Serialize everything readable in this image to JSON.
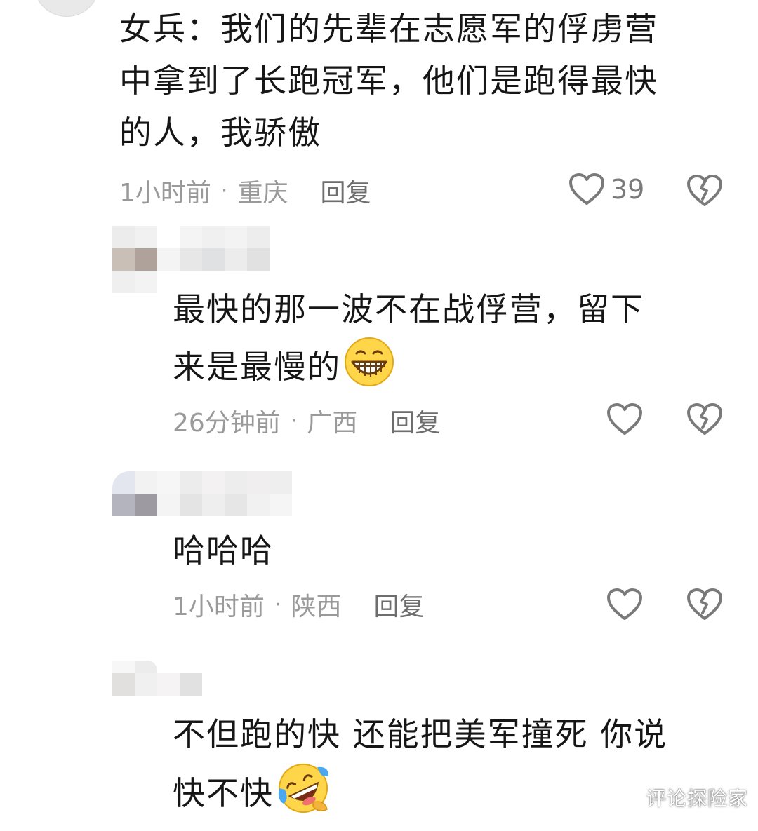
{
  "comments": [
    {
      "text_lines": [
        "女兵：我们的先辈在志愿军的俘虏营",
        "中拿到了长跑冠军，他们是跑得最快",
        "的人，我骄傲"
      ],
      "time": "1小时前",
      "location": "重庆",
      "reply_label": "回复",
      "like_count": "39"
    },
    {
      "text_lines": [
        "最快的那一波不在战俘营，留下",
        "来是最慢的"
      ],
      "emoji": "grinning-teeth-emoji",
      "time": "26分钟前",
      "location": "广西",
      "reply_label": "回复"
    },
    {
      "text_lines": [
        "哈哈哈"
      ],
      "time": "1小时前",
      "location": "陕西",
      "reply_label": "回复"
    },
    {
      "text_lines": [
        "不但跑的快 还能把美军撞死 你说",
        "快不快"
      ],
      "emoji": "rolling-laughing-emoji"
    }
  ],
  "separator": "·",
  "watermark": "评论探险家",
  "colors": {
    "text": "#161616",
    "meta": "#9a9a9a",
    "reply": "#6e6e6e",
    "icon": "#7a7a7a",
    "background": "#ffffff"
  }
}
